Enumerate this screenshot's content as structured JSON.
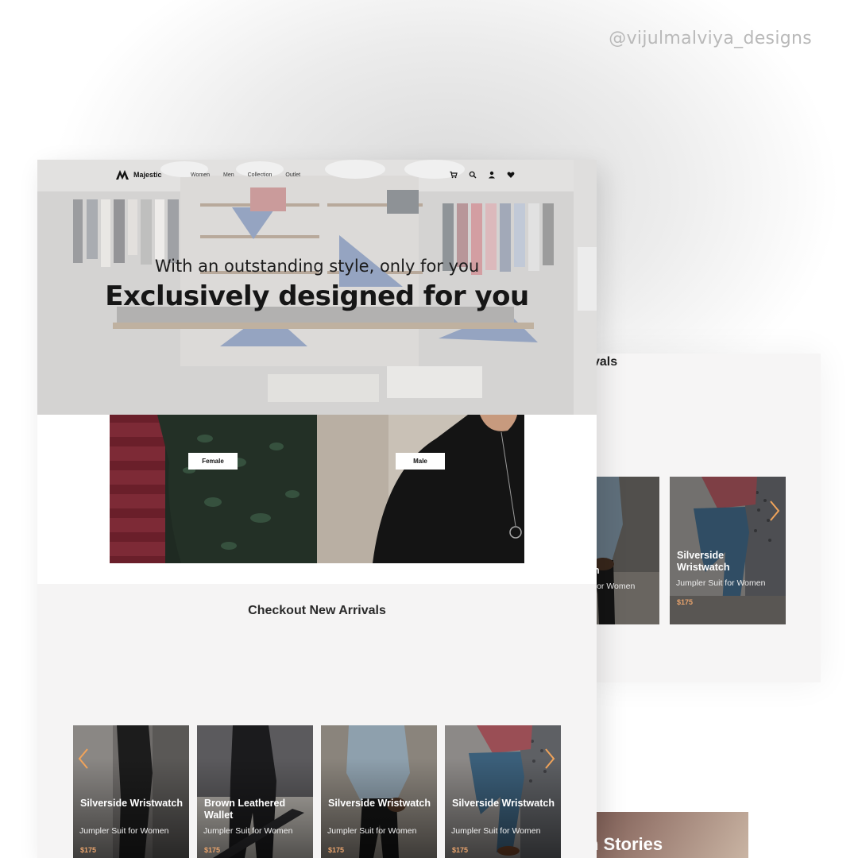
{
  "watermark": "@vijulmalviya_designs",
  "brand": {
    "name": "Majestic"
  },
  "nav": {
    "links": [
      "Women",
      "Men",
      "Collection",
      "Outlet"
    ],
    "icons": [
      "cart-icon",
      "search-icon",
      "user-icon",
      "heart-icon"
    ]
  },
  "hero": {
    "subtitle": "With an outstanding style, only for you",
    "title": "Exclusively designed for you"
  },
  "categories": [
    {
      "label": "Female"
    },
    {
      "label": "Male"
    }
  ],
  "arrivals": {
    "title": "Checkout New Arrivals",
    "products": [
      {
        "name": "Silverside Wristwatch",
        "desc": "Jumpler Suit for Women",
        "price": "$175"
      },
      {
        "name": "Brown Leathered Wallet",
        "desc": "Jumpler Suit for Women",
        "price": "$175"
      },
      {
        "name": "Silverside Wristwatch",
        "desc": "Jumpler Suit for Women",
        "price": "$175"
      },
      {
        "name": "Silverside Wristwatch",
        "desc": "Jumpler Suit for Women",
        "price": "$175"
      }
    ]
  },
  "back_mockup": {
    "title_fragment": "vals",
    "cards": [
      {
        "name": "Silverside Wristwatch",
        "name_fragment": "e\nch",
        "desc_fragment": "it for Women"
      },
      {
        "name": "Silverside Wristwatch",
        "desc": "Jumpler Suit for Women",
        "price": "$175"
      }
    ],
    "stories_fragment": "n Stories"
  },
  "colors": {
    "price": "#e8a36c",
    "arrow": "#f0a35a",
    "section_bg": "#f5f4f4"
  }
}
